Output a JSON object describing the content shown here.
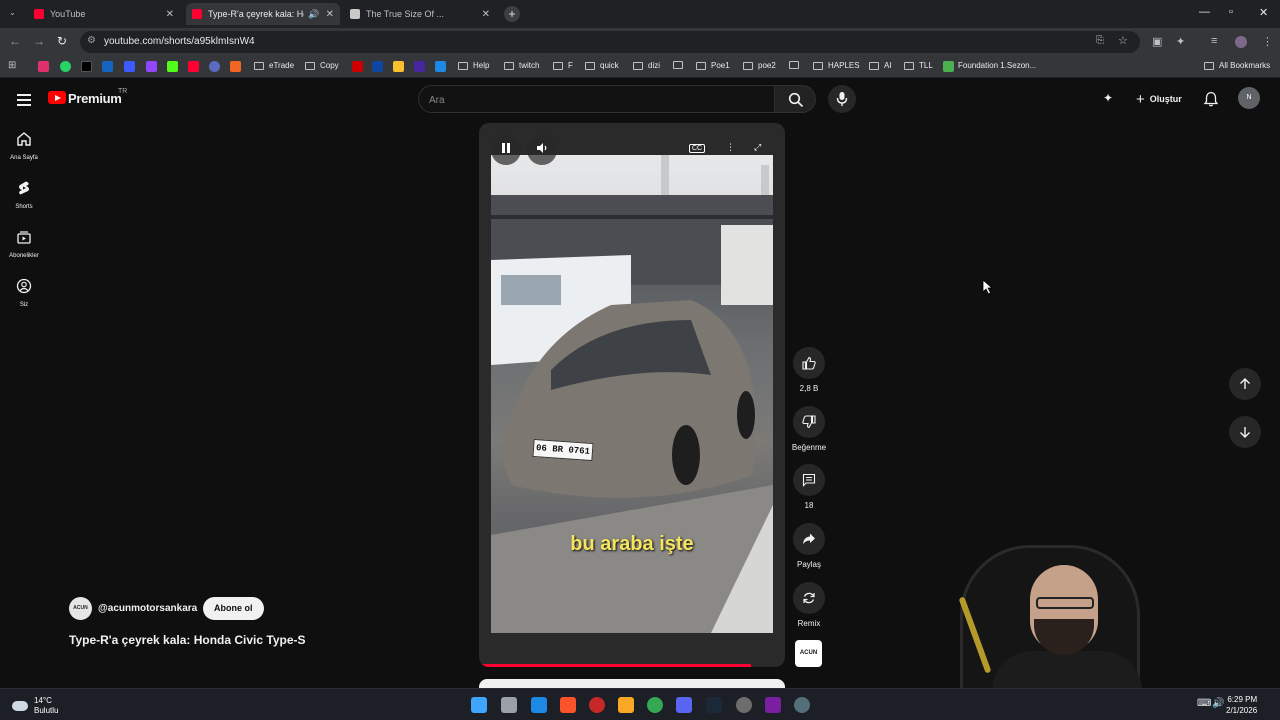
{
  "browser": {
    "tabs": [
      {
        "title": "YouTube",
        "favicon_color": "#ff0033",
        "active": false
      },
      {
        "title": "Type-R'a çeyrek kala: Honda...",
        "favicon_color": "#ff0033",
        "active": true
      },
      {
        "title": "The True Size Of ...",
        "favicon_color": "#c9c9c9",
        "active": false
      }
    ],
    "url": "youtube.com/shorts/a95klmIsnW4",
    "bookmarks": {
      "etrade": "eTrade",
      "copy": "Copy",
      "help": "Help",
      "twitch": "twitch",
      "f": "F",
      "quick": "quick",
      "dizi": "dizi",
      "poe1": "Poe1",
      "poe2": "poe2",
      "haples": "HAPLES",
      "ai": "AI",
      "tll": "TLL",
      "foundation": "Foundation 1.Sezon...",
      "all": "All Bookmarks"
    }
  },
  "youtube": {
    "brand": "Premium",
    "country": "TR",
    "search_placeholder": "Ara",
    "create_label": "Oluştur",
    "avatar_initial": "N",
    "sidebar": [
      {
        "label": "Ana Sayfa",
        "icon": "home-icon"
      },
      {
        "label": "Shorts",
        "icon": "shorts-icon"
      },
      {
        "label": "Abonelikler",
        "icon": "subscriptions-icon"
      },
      {
        "label": "Siz",
        "icon": "you-icon"
      }
    ],
    "short": {
      "subtitle": "bu araba işte",
      "plate": "06 BR 0761",
      "progress": 0.89,
      "likes": "2,8 B",
      "dislike_label": "Beğenme",
      "comments": "18",
      "share_label": "Paylaş",
      "remix_label": "Remix",
      "channel": "@acunmotorsankara",
      "subscribe_label": "Abone ol",
      "title": "Type-R'a çeyrek kala: Honda Civic Type-S",
      "channel_logo_text": "ACUN"
    }
  },
  "taskbar": {
    "temperature": "14°C",
    "weather": "Bulutlu",
    "time": "6:29 PM",
    "date": "2/1/2026"
  },
  "colors": {
    "yt_red": "#ff0000",
    "accent_progress": "#ff0033",
    "subtitle_yellow": "#f5e55a"
  }
}
